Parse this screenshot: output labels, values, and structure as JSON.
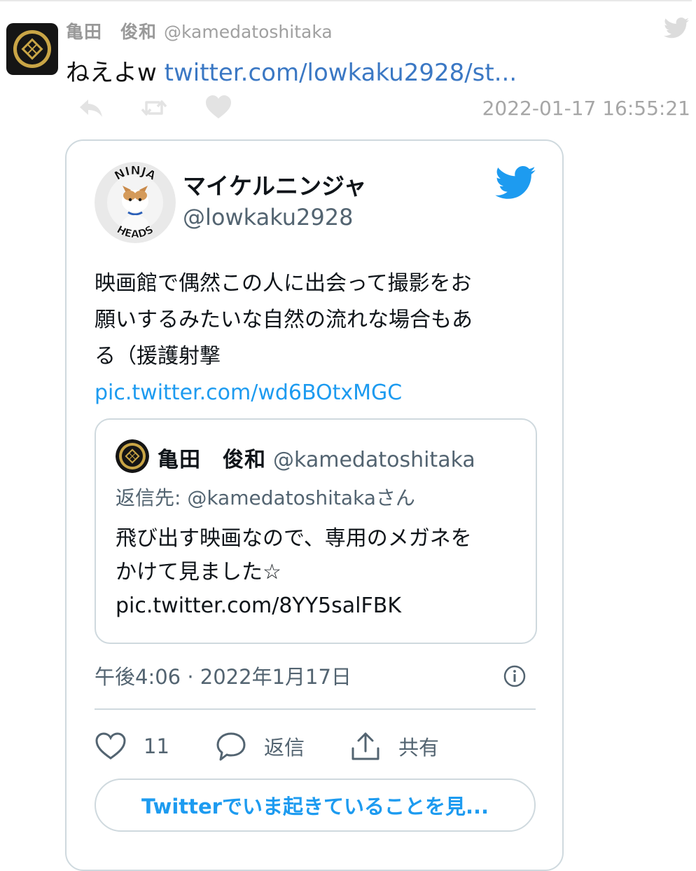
{
  "outer_tweet": {
    "display_name": "亀田　俊和",
    "handle": "@kamedatoshitaka",
    "text": "ねえよw ",
    "link_text": "twitter.com/lowkaku2928/st...",
    "timestamp": "2022-01-17 16:55:21",
    "icons": [
      "reply-icon",
      "retweet-icon",
      "like-icon",
      "twitter-bird-icon"
    ]
  },
  "embedded_tweet": {
    "display_name": "マイケルニンジャ",
    "handle": "@lowkaku2928",
    "avatar_text": {
      "top": "NINJA",
      "bottom": "HEADS"
    },
    "body_lines": [
      "映画館で偶然この人に出会って撮影をお",
      "願いするみたいな自然の流れな場合もあ",
      "る（援護射撃"
    ],
    "body_link": "pic.twitter.com/wd6BOtxMGC",
    "quoted": {
      "display_name": "亀田　俊和",
      "handle": "@kamedatoshitaka",
      "reply_to": "返信先: @kamedatoshitakaさん",
      "body_lines": [
        "飛び出す映画なので、専用のメガネを",
        "かけて見ました☆",
        "pic.twitter.com/8YY5salFBK"
      ]
    },
    "date": "午後4:06 · 2022年1月17日",
    "like_count": "11",
    "reply_label": "返信",
    "share_label": "共有",
    "cta_label": "Twitterでいま起きていることを見..."
  },
  "colors": {
    "link": "#1d9bf0",
    "outer_link": "#3b78c4",
    "muted": "#536471",
    "border": "#cfd9de",
    "crest_gold": "#b8963a"
  }
}
